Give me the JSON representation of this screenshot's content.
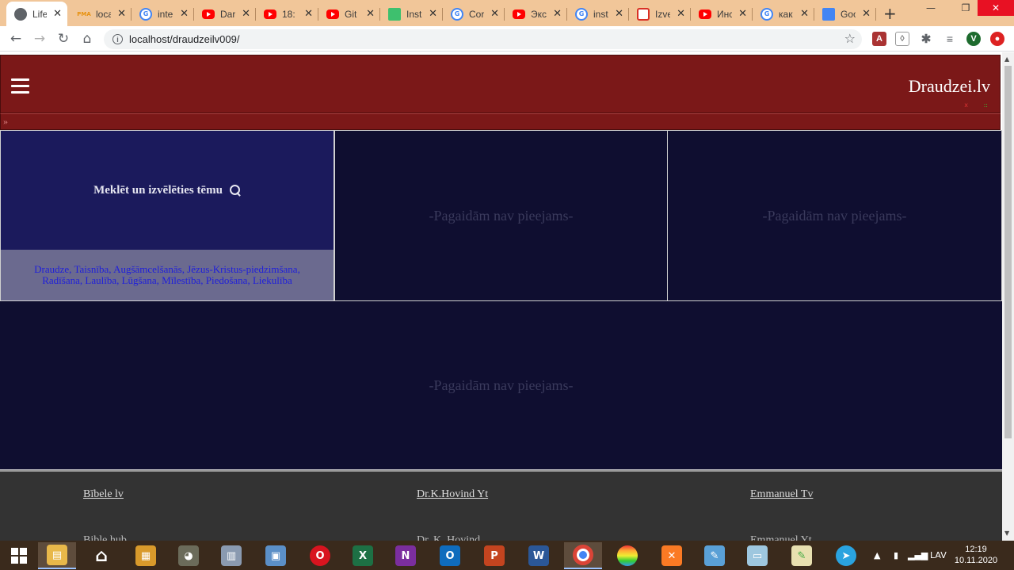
{
  "browser": {
    "tabs": [
      {
        "title": "Life",
        "icon": "globe-icon",
        "active": true
      },
      {
        "title": "localhost",
        "icon": "phpmyadmin-icon",
        "favtext": "PMA"
      },
      {
        "title": "inter",
        "icon": "google-icon",
        "favtext": "G"
      },
      {
        "title": "Dar",
        "icon": "youtube-icon"
      },
      {
        "title": "18:",
        "icon": "youtube-icon"
      },
      {
        "title": "Git",
        "icon": "youtube-icon"
      },
      {
        "title": "Inst",
        "icon": "instagram-icon"
      },
      {
        "title": "Cor",
        "icon": "google-icon",
        "favtext": "G"
      },
      {
        "title": "Экс",
        "icon": "youtube-icon"
      },
      {
        "title": "inst",
        "icon": "google-icon",
        "favtext": "G"
      },
      {
        "title": "Izve",
        "icon": "mail-icon"
      },
      {
        "title": "Инс",
        "icon": "youtube-icon"
      },
      {
        "title": "как",
        "icon": "google-icon",
        "favtext": "G"
      },
      {
        "title": "Goo",
        "icon": "google-translate-icon"
      }
    ],
    "address": "localhost/draudzeilv009/",
    "profile_initial": "V"
  },
  "site": {
    "brand": "Draudzei.lv",
    "header_x": "x",
    "header_dots": "::",
    "breadcrumb_marker": "»",
    "search": {
      "label": "Meklēt un izvēlēties tēmu",
      "topics": "Draudze, Taisnība, Augšāmcelšanās, Jēzus-Kristus-piedzimšana, Radīšana, Laulība, Lūgšana, Mīlestība, Piedošana, Liekulība"
    },
    "unavailable": "-Pagaidām nav pieejams-",
    "footer": {
      "links": [
        "Bībele lv",
        "Dr.K.Hovind Yt",
        "Emmanuel Tv"
      ],
      "second_row": [
        "Bible hub",
        "Dr. K. Hovind",
        "Emmanuel Yt"
      ]
    }
  },
  "taskbar": {
    "language": "LAV",
    "time": "12:19",
    "date": "10.11.2020"
  },
  "colors": {
    "header_bg": "#7b1818",
    "panel_bg": "#0f0e30",
    "search_bg": "#1b1a5c",
    "topics_bg": "#6b6a8f",
    "footer_bg": "#333333"
  }
}
